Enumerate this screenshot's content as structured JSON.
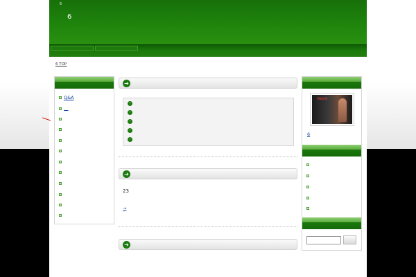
{
  "header": {
    "subtitle": "6",
    "title": "6"
  },
  "breadcrumb": {
    "text": "6 TOP"
  },
  "left_sidebar": {
    "items": [
      {
        "label": "Q&A"
      },
      {
        "label": "__"
      },
      {
        "label": ""
      },
      {
        "label": ""
      },
      {
        "label": ""
      },
      {
        "label": ""
      },
      {
        "label": ""
      },
      {
        "label": ""
      },
      {
        "label": ""
      },
      {
        "label": ""
      },
      {
        "label": ""
      },
      {
        "label": ""
      }
    ]
  },
  "main": {
    "section2": {
      "count_text": "23",
      "more_link": "→"
    }
  },
  "right_sidebar": {
    "ad_caption": "6",
    "ad_text_line1": "ON&ON",
    "ad_text_line2": "",
    "list_items": [
      {
        "label": ""
      },
      {
        "label": ""
      },
      {
        "label": ""
      },
      {
        "label": ""
      },
      {
        "label": ""
      }
    ]
  },
  "colors": {
    "brand_green": "#1b7a0d",
    "header_green": "#2a9010"
  }
}
